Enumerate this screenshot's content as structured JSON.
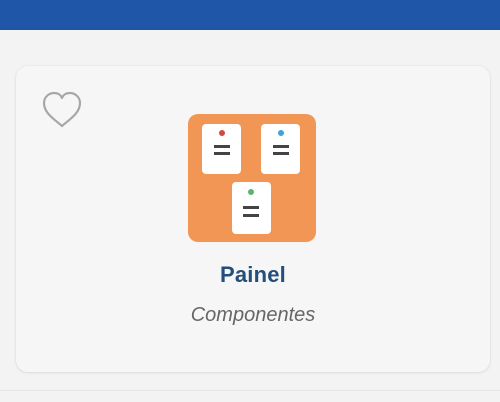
{
  "header": {
    "color": "#1f56a7"
  },
  "card": {
    "favorite_icon": "heart-outline-icon",
    "app_icon": "kanban-board-icon",
    "app_icon_color": "#f29655",
    "title": "Painel",
    "subtitle": "Componentes"
  }
}
